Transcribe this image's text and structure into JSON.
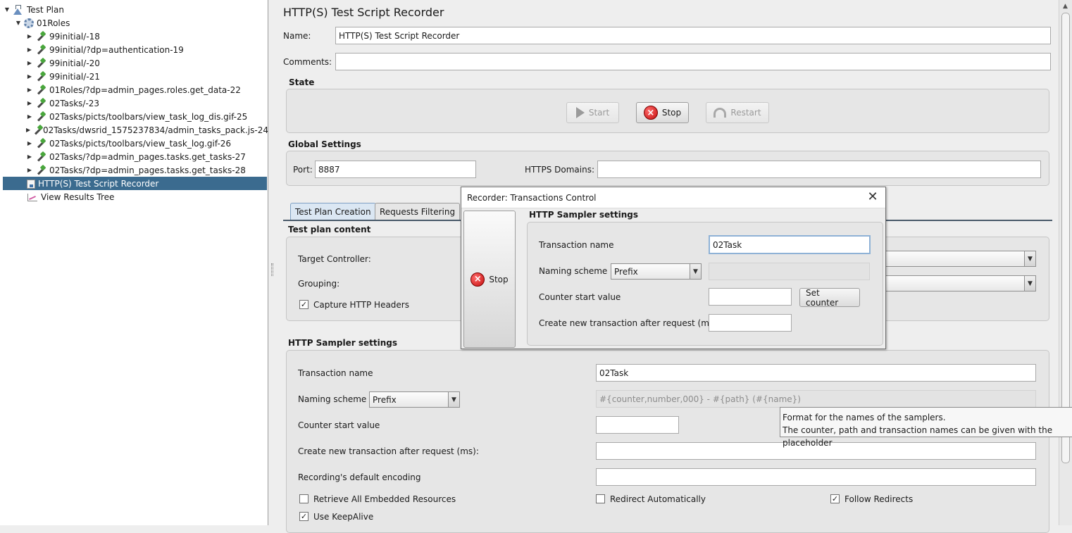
{
  "tree": {
    "nodes": [
      {
        "label": "Test Plan",
        "icon": "test-plan-icon"
      },
      {
        "label": "01Roles",
        "icon": "thread-group-icon"
      },
      {
        "label": "99initial/-18",
        "icon": "http-sampler-icon"
      },
      {
        "label": "99initial/?dp=authentication-19",
        "icon": "http-sampler-icon"
      },
      {
        "label": "99initial/-20",
        "icon": "http-sampler-icon"
      },
      {
        "label": "99initial/-21",
        "icon": "http-sampler-icon"
      },
      {
        "label": "01Roles/?dp=admin_pages.roles.get_data-22",
        "icon": "http-sampler-icon"
      },
      {
        "label": "02Tasks/-23",
        "icon": "http-sampler-icon"
      },
      {
        "label": "02Tasks/picts/toolbars/view_task_log_dis.gif-25",
        "icon": "http-sampler-icon"
      },
      {
        "label": "02Tasks/dwsrid_1575237834/admin_tasks_pack.js-24",
        "icon": "http-sampler-icon"
      },
      {
        "label": "02Tasks/picts/toolbars/view_task_log.gif-26",
        "icon": "http-sampler-icon"
      },
      {
        "label": "02Tasks/?dp=admin_pages.tasks.get_tasks-27",
        "icon": "http-sampler-icon"
      },
      {
        "label": "02Tasks/?dp=admin_pages.tasks.get_tasks-28",
        "icon": "http-sampler-icon"
      },
      {
        "label": "HTTP(S) Test Script Recorder",
        "icon": "recorder-icon",
        "selected": true
      },
      {
        "label": "View Results Tree",
        "icon": "results-tree-icon"
      }
    ]
  },
  "main": {
    "title": "HTTP(S) Test Script Recorder",
    "name_label": "Name:",
    "name_value": "HTTP(S) Test Script Recorder",
    "comments_label": "Comments:",
    "comments_value": "",
    "state": {
      "title": "State",
      "start_label": "Start",
      "stop_label": "Stop",
      "restart_label": "Restart"
    },
    "global": {
      "title": "Global Settings",
      "port_label": "Port:",
      "port_value": "8887",
      "domains_label": "HTTPS Domains:",
      "domains_value": ""
    },
    "tabs": [
      "Test Plan Creation",
      "Requests Filtering"
    ],
    "content": {
      "title": "Test plan content",
      "target_label": "Target Controller:",
      "grouping_label": "Grouping:",
      "capture_label": "Capture HTTP Headers",
      "capture_checked": true
    },
    "sampler": {
      "title": "HTTP Sampler settings",
      "transaction_label": "Transaction name",
      "transaction_value": "02Task",
      "naming_label": "Naming scheme",
      "naming_value": "Prefix",
      "format_value": "#{counter,number,000} - #{path} (#{name})",
      "counter_label": "Counter start value",
      "counter_value": "",
      "create_label": "Create new transaction after request (ms):",
      "create_value": "",
      "encoding_label": "Recording's default encoding",
      "encoding_value": "",
      "retrieve_label": "Retrieve All Embedded Resources",
      "retrieve_checked": false,
      "redirect_label": "Redirect Automatically",
      "redirect_checked": false,
      "follow_label": "Follow Redirects",
      "follow_checked": true,
      "keepalive_label": "Use KeepAlive",
      "keepalive_checked": true
    }
  },
  "tooltip": {
    "line1": "Format for the names of the samplers.",
    "line2": "The counter, path and transaction names can be given with the placeholder"
  },
  "dialog": {
    "title": "Recorder: Transactions Control",
    "stop_label": "Stop",
    "section_title": "HTTP Sampler settings",
    "transaction_label": "Transaction name",
    "transaction_value": "02Task",
    "naming_label": "Naming scheme",
    "naming_value": "Prefix",
    "counter_label": "Counter start value",
    "counter_value": "",
    "set_counter_label": "Set counter",
    "create_label": "Create new transaction after request (ms):",
    "create_value": ""
  },
  "colors": {
    "selection": "#3b6b8f",
    "stop_red": "#c40d0d"
  }
}
